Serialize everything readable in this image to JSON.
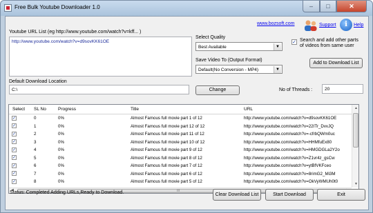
{
  "window": {
    "title": "Free Bulk Youtube Downloader 1.0",
    "minimize": "–",
    "maximize": "□",
    "close": "✕"
  },
  "header": {
    "site_link": "www.bozsoft.com",
    "support_link": "Support",
    "help_link": "Help",
    "support_icon": "support-people-icon",
    "help_icon": "info-icon"
  },
  "url_list": {
    "label": "Youtube URL List (eg http://www.youtube.com/watch?v=kff... )",
    "value": "http://www.youtube.com/watch?v=d9sovKK61OE"
  },
  "quality": {
    "label": "Select Quality",
    "selected": "Best Available"
  },
  "format": {
    "label": "Save Video To (Output Format)",
    "selected": "Default(No Conversion - MP4)"
  },
  "search_parts": {
    "checked": true,
    "label_line1": "Search and add other parts",
    "label_line2": "of videos from same  user"
  },
  "add_button": "Add to Download List",
  "download_location": {
    "label": "Default Download Location",
    "value": "C:\\",
    "change_button": "Change"
  },
  "threads": {
    "label": "No of Threads :",
    "value": "20"
  },
  "table": {
    "columns": [
      "Select",
      "SL No",
      "Progress",
      "Title",
      "URL"
    ],
    "rows": [
      {
        "sl": "0",
        "progress": "0%",
        "title": "Almost Famous full movie part 1 of 12",
        "url": "http://www.youtube.com/watch?v=d9sovKK61OE"
      },
      {
        "sl": "1",
        "progress": "0%",
        "title": "Almost Famous full movie part 12 of 12",
        "url": "http://www.youtube.com/watch?v=22ITr_DvvJQ"
      },
      {
        "sl": "2",
        "progress": "0%",
        "title": "Almost Famous full movie part 11 of 12",
        "url": "http://www.youtube.com/watch?v=-cfrbQWm0uc"
      },
      {
        "sl": "3",
        "progress": "0%",
        "title": "Almost Famous full movie part 10 of 12",
        "url": "http://www.youtube.com/watch?v=HHMfuEx80"
      },
      {
        "sl": "4",
        "progress": "0%",
        "title": "Almost Famous full movie part 9 of 12",
        "url": "http://www.youtube.com/watch?v=HMGDGLa2Y2o"
      },
      {
        "sl": "5",
        "progress": "0%",
        "title": "Almost Famous full movie part 8 of 12",
        "url": "http://www.youtube.com/watch?v=Z1vr4z_gsCw"
      },
      {
        "sl": "6",
        "progress": "0%",
        "title": "Almost Famous full movie part 7 of 12",
        "url": "http://www.youtube.com/watch?v=ytBfVKFceo"
      },
      {
        "sl": "7",
        "progress": "0%",
        "title": "Almost Famous full movie part 6 of 12",
        "url": "http://www.youtube.com/watch?v=8rimG2_Mi3M"
      },
      {
        "sl": "8",
        "progress": "0%",
        "title": "Almost Famous full movie part 5 of 12",
        "url": "http://www.youtube.com/watch?v=OkVyWMUh0t0"
      }
    ],
    "hscroll_grip": "III"
  },
  "status": "Status: Completed Adding URLs,Ready to Download.",
  "buttons": {
    "clear": "Clear Download List",
    "start": "Start Download",
    "exit": "Exit"
  }
}
